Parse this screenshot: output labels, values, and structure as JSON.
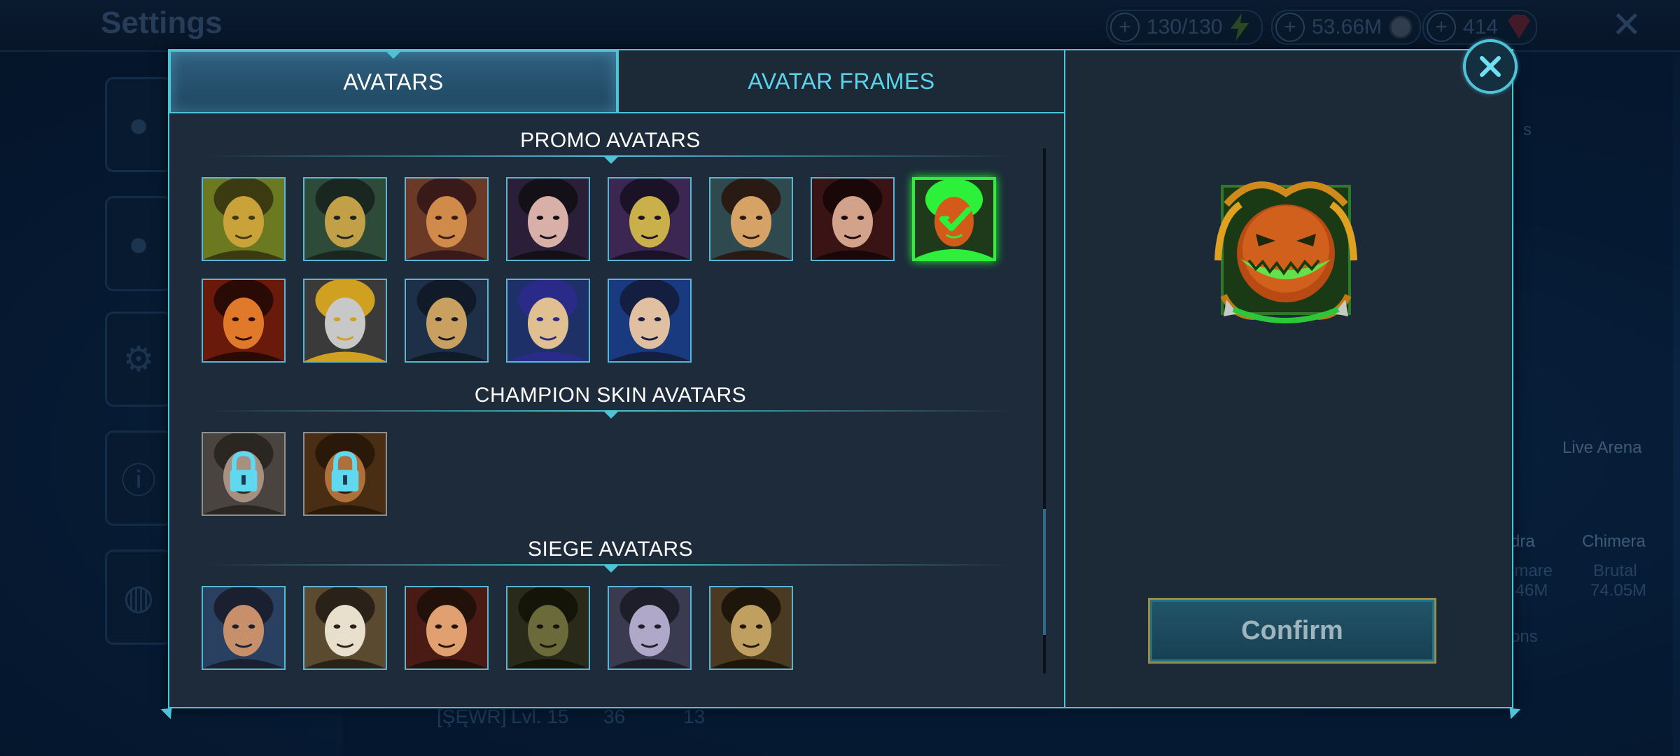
{
  "background": {
    "title": "Settings",
    "resources": [
      {
        "value": "130/130",
        "icon": "lightning-icon"
      },
      {
        "value": "53.66M",
        "icon": "silver-coin-icon"
      },
      {
        "value": "414",
        "icon": "ruby-gem-icon"
      }
    ],
    "right_labels": {
      "live_arena": "Live Arena",
      "hydra_partial": "dra",
      "chimera": "Chimera",
      "nightmare_partial": "imare",
      "brutal": "Brutal",
      "hydra_damage_partial": ".46M",
      "chimera_damage": "74.05M",
      "tags_partial": "s",
      "options_partial": "ons"
    },
    "profile": {
      "clan": "[ŞĘWR]",
      "level": "Lvl. 15",
      "trophies": "36",
      "cups": "13"
    }
  },
  "dialog": {
    "tabs": [
      {
        "label": "AVATARS",
        "active": true
      },
      {
        "label": "AVATAR FRAMES",
        "active": false
      }
    ],
    "sections": [
      {
        "title": "PROMO AVATARS",
        "avatars": [
          {
            "name": "turtle-face",
            "colors": [
              "#6b7a20",
              "#c9a33a",
              "#3b3a10"
            ]
          },
          {
            "name": "gold-helmet-knight",
            "colors": [
              "#2e4a38",
              "#c2a048",
              "#1a2620"
            ]
          },
          {
            "name": "bald-warrior",
            "colors": [
              "#6b3a26",
              "#d08a4a",
              "#3a1a18"
            ]
          },
          {
            "name": "dark-haired-woman",
            "colors": [
              "#2a1e38",
              "#d9b0a8",
              "#141018"
            ]
          },
          {
            "name": "gold-skull",
            "colors": [
              "#3b2752",
              "#c9b04a",
              "#1c1228"
            ]
          },
          {
            "name": "blonde-warrior",
            "colors": [
              "#2e4a4e",
              "#d6a266",
              "#2a1a14"
            ]
          },
          {
            "name": "red-haired-lady",
            "colors": [
              "#3a1414",
              "#d2a28a",
              "#1a0808"
            ]
          },
          {
            "name": "pumpkin-monster",
            "colors": [
              "#1e3a1a",
              "#d45a1a",
              "#2cf03a"
            ],
            "selected": true
          },
          {
            "name": "fire-demon",
            "colors": [
              "#6a1a0a",
              "#e07a2a",
              "#2a0a04"
            ]
          },
          {
            "name": "crusader-helm",
            "colors": [
              "#3a3a3a",
              "#c8c8c8",
              "#d0a020"
            ]
          },
          {
            "name": "elf-king",
            "colors": [
              "#1e3048",
              "#c9a060",
              "#101a28"
            ]
          },
          {
            "name": "blue-haired-elf",
            "colors": [
              "#1e3068",
              "#e0c090",
              "#2a2a88"
            ]
          },
          {
            "name": "scarred-blonde",
            "colors": [
              "#1a3a80",
              "#e0c0a0",
              "#141e40"
            ]
          }
        ]
      },
      {
        "title": "CHAMPION SKIN AVATARS",
        "avatars": [
          {
            "name": "locked-lady",
            "colors": [
              "#4a4440",
              "#a89080",
              "#2a2622"
            ],
            "locked": true
          },
          {
            "name": "locked-beast",
            "colors": [
              "#4a2e14",
              "#b0703a",
              "#2a1808"
            ],
            "locked": true
          }
        ]
      },
      {
        "title": "SIEGE AVATARS",
        "avatars": [
          {
            "name": "bearded-soldier",
            "colors": [
              "#2a4060",
              "#c8906a",
              "#1a2030"
            ]
          },
          {
            "name": "white-lion",
            "colors": [
              "#5a4a30",
              "#e8e0cc",
              "#2a2218"
            ]
          },
          {
            "name": "red-queen",
            "colors": [
              "#4a1a14",
              "#e0a070",
              "#22100a"
            ]
          },
          {
            "name": "green-ogre",
            "colors": [
              "#2a2a1a",
              "#6a6a3a",
              "#141408"
            ]
          },
          {
            "name": "pale-dark-elf",
            "colors": [
              "#3a3a50",
              "#b0a8c8",
              "#1e1e2a"
            ]
          },
          {
            "name": "golden-ape",
            "colors": [
              "#4a3a22",
              "#c0a060",
              "#1e160a"
            ]
          }
        ]
      }
    ],
    "preview": {
      "name": "pumpkin-monster-framed"
    },
    "confirm_label": "Confirm"
  },
  "colors": {
    "accent": "#4fc3d6",
    "selected": "#2cf03a",
    "panel": "#1d2b3a"
  }
}
